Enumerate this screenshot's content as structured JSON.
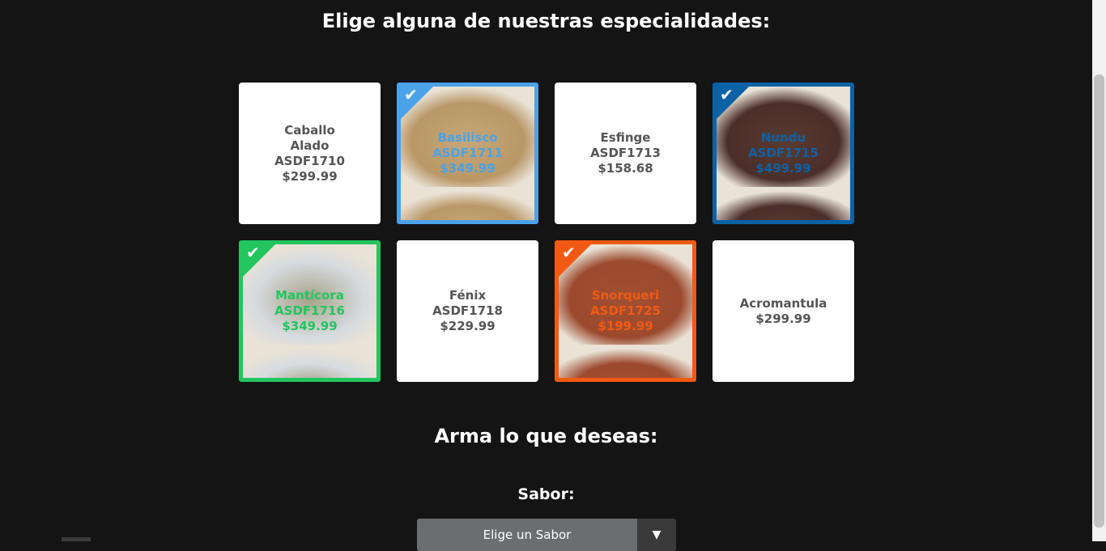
{
  "specialties": {
    "title": "Elige alguna de nuestras especialidades:",
    "cards": [
      {
        "text": "Caballo\nAlado\nASDF1710\n$299.99",
        "selected": false
      },
      {
        "text": "Basilisco\nASDF1711\n$349.99",
        "selected": true,
        "accent": "#4aa3e8",
        "photo": "nut-fruit-cake",
        "photo_top": "#b99766",
        "photo_bottom": "#c7a77a"
      },
      {
        "text": "Esfinge\nASDF1713\n$158.68",
        "selected": false
      },
      {
        "text": "Nundu\nASDF1715\n$499.99",
        "selected": true,
        "accent": "#0d62a6",
        "photo": "cinnamon-cream-cake",
        "photo_top": "#4a2e2a",
        "photo_bottom": "#5a3b30"
      },
      {
        "text": "Mantícora\nASDF1716\n$349.99",
        "selected": true,
        "accent": "#22c55e",
        "photo": "carrot-cake",
        "photo_top": "#d7dce0",
        "photo_bottom": "#a7a28a"
      },
      {
        "text": "Fénix\nASDF1718\n$229.99",
        "selected": false
      },
      {
        "text": "Snorqueri\nASDF1725\n$199.99",
        "selected": true,
        "accent": "#f25a14",
        "photo": "bundt-cake",
        "photo_top": "#9c4a2e",
        "photo_bottom": "#a14f32"
      },
      {
        "text": "Acromantula\n$299.99",
        "selected": false
      }
    ]
  },
  "builder": {
    "title": "Arma lo que deseas:",
    "flavor_label": "Sabor:",
    "flavor_select": {
      "value": "Elige un Sabor",
      "arrow": "▼"
    }
  },
  "icons": {
    "check": "✔"
  }
}
